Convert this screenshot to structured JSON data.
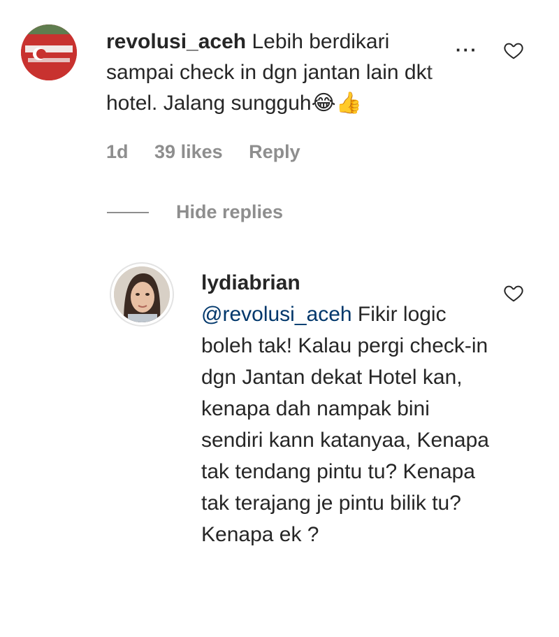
{
  "comment": {
    "username": "revolusi_aceh",
    "text": "Lebih berdikari sampai check in dgn jantan lain dkt hotel. Jalang sungguh",
    "emoji": "😂👍",
    "time": "1d",
    "likes": "39 likes",
    "reply_label": "Reply",
    "more_label": "···"
  },
  "replies_toggle": {
    "label": "Hide replies"
  },
  "reply": {
    "username": "lydiabrian",
    "mention": "@revolusi_aceh",
    "text": "Fikir logic boleh tak! Kalau pergi check-in dgn Jantan dekat Hotel kan, kenapa dah nampak bini sendiri kann katanyaa, Kenapa tak tendang pintu tu? Kenapa tak terajang je pintu bilik tu? Kenapa ek ?"
  },
  "icons": {
    "comment_heart": "heart-outline-icon",
    "reply_heart": "heart-outline-icon",
    "more": "more-horizontal-icon"
  }
}
